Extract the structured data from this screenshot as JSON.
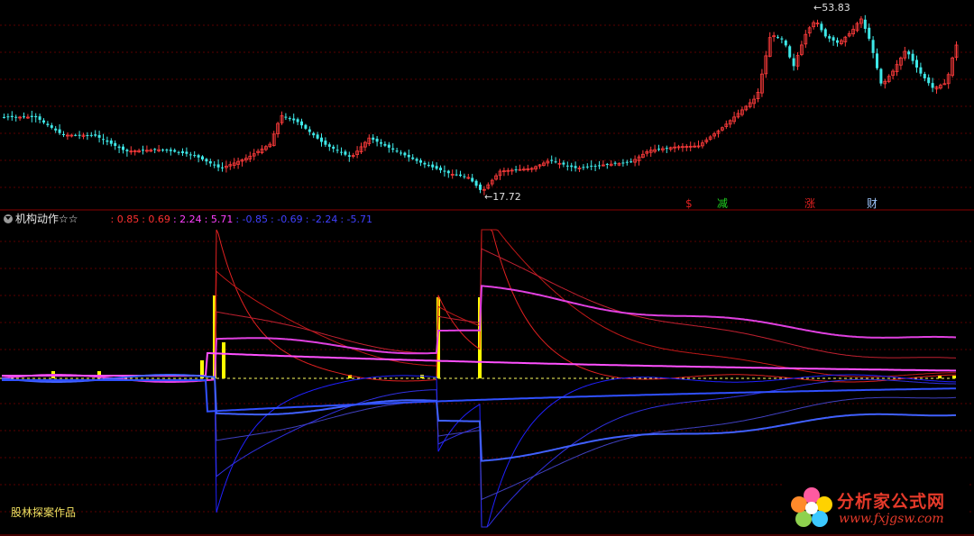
{
  "main_chart": {
    "high_label": "53.83",
    "low_label": "17.72",
    "high_arrow": "←",
    "low_arrow": "←",
    "signals": [
      {
        "text": "$",
        "color": "#e02020"
      },
      {
        "text": "减",
        "color": "#20d020"
      },
      {
        "text": "涨",
        "color": "#e02020"
      },
      {
        "text": "财",
        "color": "#a0c8ff"
      }
    ]
  },
  "indicator": {
    "title": "机构动作☆☆",
    "values": [
      {
        "text": ": 0.85",
        "color": "#ff3030"
      },
      {
        "text": ": 0.69",
        "color": "#ff3030"
      },
      {
        "text": ": 2.24",
        "color": "#ff40ff"
      },
      {
        "text": ": 5.71",
        "color": "#ff40ff"
      },
      {
        "text": ": -0.85",
        "color": "#4040ff"
      },
      {
        "text": ": -0.69",
        "color": "#4040ff"
      },
      {
        "text": ": -2.24",
        "color": "#4040ff"
      },
      {
        "text": ": -5.71",
        "color": "#4040ff"
      }
    ]
  },
  "author": "股林探案作品",
  "watermark": {
    "cn": "分析家公式网",
    "en": "www.fxjgsw.com"
  },
  "colors": {
    "up": "#ff3b3b",
    "down": "#3ee8e8",
    "grid": "#5a0000",
    "bar": "#ffff00"
  }
}
